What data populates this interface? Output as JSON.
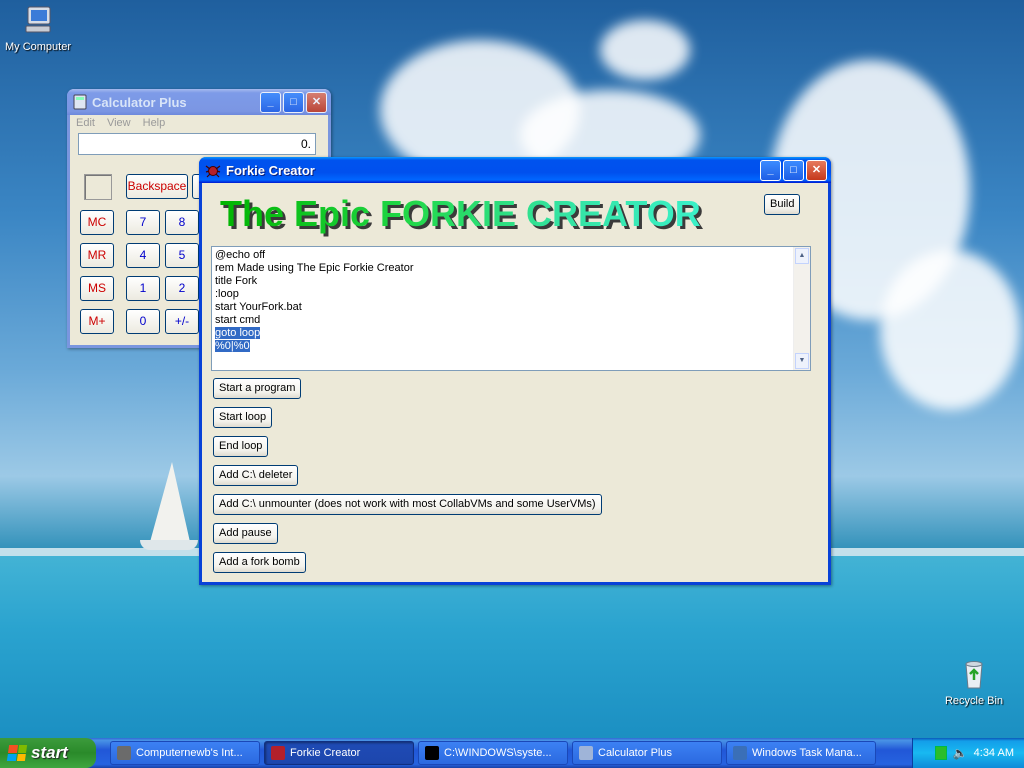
{
  "desktop": {
    "icons": [
      {
        "label": "My Computer"
      },
      {
        "label": "Recycle Bin"
      }
    ]
  },
  "calculator": {
    "title": "Calculator Plus",
    "menu": [
      "Edit",
      "View",
      "Help"
    ],
    "display": "0.",
    "backspace": "Backspace",
    "memory_keys": [
      "MC",
      "MR",
      "MS",
      "M+"
    ],
    "digit_keys": [
      "7",
      "8",
      "4",
      "5",
      "1",
      "2",
      "0",
      "+/-"
    ]
  },
  "forkie": {
    "title": "Forkie Creator",
    "banner": "The Epic FORKIE CREATOR",
    "build_label": "Build",
    "code_lines": [
      {
        "text": "@echo off",
        "selected": false
      },
      {
        "text": "rem Made using The Epic Forkie Creator",
        "selected": false
      },
      {
        "text": "title Fork",
        "selected": false
      },
      {
        "text": ":loop",
        "selected": false
      },
      {
        "text": "start YourFork.bat",
        "selected": false
      },
      {
        "text": "start cmd",
        "selected": false
      },
      {
        "text": "goto loop",
        "selected": true
      },
      {
        "text": "%0|%0",
        "selected": true
      }
    ],
    "buttons": [
      "Start a program",
      "Start loop",
      "End loop",
      "Add C:\\ deleter",
      "Add C:\\ unmounter (does not work with most CollabVMs and some UserVMs)",
      "Add pause",
      "Add a fork bomb"
    ]
  },
  "taskbar": {
    "start_label": "start",
    "tasks": [
      {
        "label": "Computernewb's Int...",
        "active": false,
        "icon_color": "#6b6b6b"
      },
      {
        "label": "Forkie Creator",
        "active": true,
        "icon_color": "#b3202a"
      },
      {
        "label": "C:\\WINDOWS\\syste...",
        "active": false,
        "icon_color": "#000000"
      },
      {
        "label": "Calculator Plus",
        "active": false,
        "icon_color": "#9fb4d8"
      },
      {
        "label": "Windows Task Mana...",
        "active": false,
        "icon_color": "#3a6fb8"
      }
    ],
    "clock": "4:34 AM"
  },
  "colors": {
    "xp_blue": "#0842d8",
    "selection": "#316ac5",
    "banner_green": "#22d84a"
  }
}
